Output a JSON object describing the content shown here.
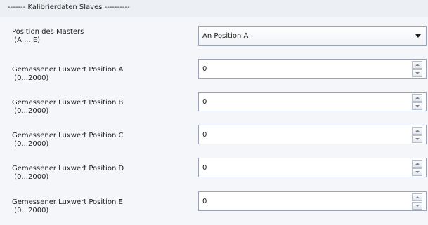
{
  "section": {
    "title": "------- Kalibrierdaten Slaves ----------"
  },
  "master": {
    "label": "Position des Masters\n (A ... E)",
    "selected": "An Position A"
  },
  "rows": [
    {
      "label": "Gemessener Luxwert Position A\n (0...2000)",
      "value": "0"
    },
    {
      "label": "Gemessener Luxwert Position B\n (0...2000)",
      "value": "0"
    },
    {
      "label": "Gemessener Luxwert Position C\n (0...2000)",
      "value": "0"
    },
    {
      "label": "Gemessener Luxwert Position D\n (0...2000)",
      "value": "0"
    },
    {
      "label": "Gemessener Luxwert Position E\n (0...2000)",
      "value": "0"
    }
  ]
}
